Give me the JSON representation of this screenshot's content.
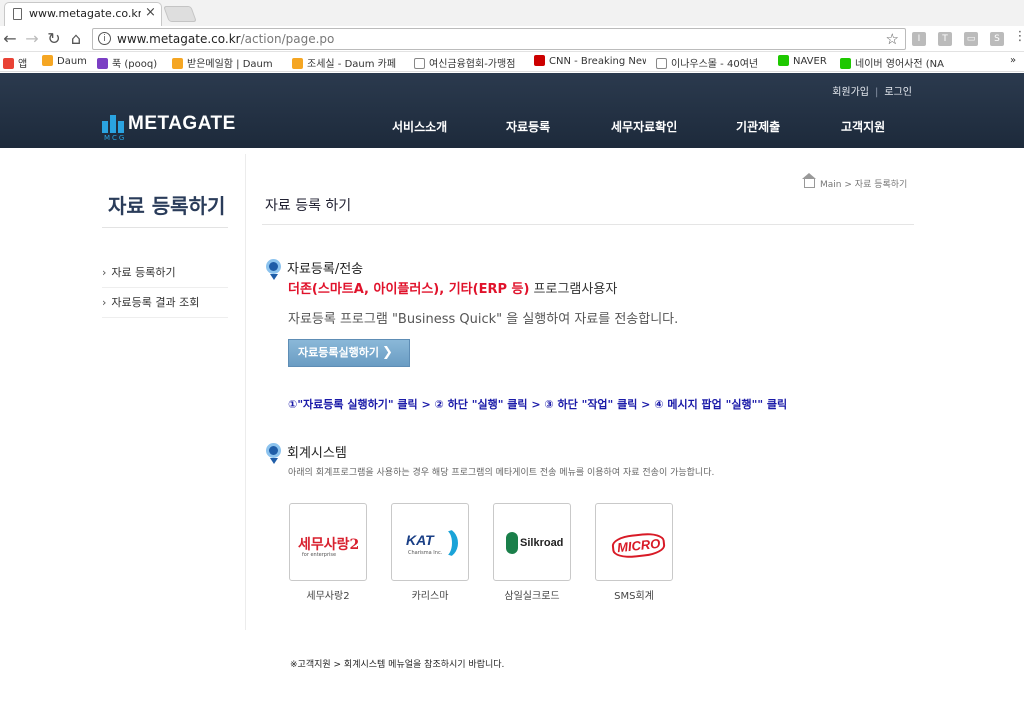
{
  "browser": {
    "tab_title": "www.metagate.co.kr/act",
    "tab_close": "×",
    "url_host": "www.metagate.co.kr",
    "url_path": "/action/page.po",
    "bookmarks": [
      {
        "label": "앱",
        "color": "#e94235"
      },
      {
        "label": "Daum",
        "color": "#f5a623"
      },
      {
        "label": "푹 (pooq)",
        "color": "#7b3fc4"
      },
      {
        "label": "받은메일함 | Daum",
        "color": "#f5a623"
      },
      {
        "label": "조세실 - Daum 카페",
        "color": "#f5a623"
      },
      {
        "label": "여신금융협회-가맹점",
        "color": "#888888"
      },
      {
        "label": "CNN - Breaking New",
        "color": "#cc0000"
      },
      {
        "label": "이나우스몰 - 40여년",
        "color": "#888888"
      },
      {
        "label": "NAVER",
        "color": "#1ec800"
      },
      {
        "label": "네이버 영어사전 (NA",
        "color": "#1ec800"
      }
    ]
  },
  "header": {
    "join": "회원가입",
    "login": "로그인",
    "logo_text": "METAGATE",
    "logo_sub": "MCG",
    "nav": [
      "서비스소개",
      "자료등록",
      "세무자료확인",
      "기관제출",
      "고객지원"
    ]
  },
  "sidebar": {
    "title": "자료 등록하기",
    "items": [
      {
        "label": "자료 등록하기"
      },
      {
        "label": "자료등록 결과 조회"
      }
    ]
  },
  "main": {
    "breadcrumb_home": "Main",
    "breadcrumb_sep": ">",
    "breadcrumb_current": "자료 등록하기",
    "page_title": "자료 등록 하기",
    "section1_title": "자료등록/전송",
    "red_text": "더존(스마트A, 아이플러스), 기타(ERP 등)",
    "red_rest": " 프로그램사용자",
    "desc": "자료등록 프로그램 \"Business Quick\" 을 실행하여 자료를 전송합니다.",
    "run_button": "자료등록실행하기",
    "steps": "①\"자료등록 실행하기\" 클릭 > ② 하단 \"실행\" 클릭 > ③ 하단 \"작업\" 클릭 > ④ 메시지 팝업 \"실행\"\" 클릭",
    "section2_title": "회계시스템",
    "section2_desc": "아래의 회계프로그램을 사용하는 경우 해당 프로그램의 메타게이트 전송 메뉴를 이용하여 자료 전송이 가능합니다.",
    "programs": [
      {
        "label": "세무사랑2",
        "logo": "세무사랑2",
        "logo_sub": "for enterprise"
      },
      {
        "label": "카리스마",
        "logo": "KAT",
        "logo_sub": "Charisma Inc."
      },
      {
        "label": "삼일실크로드",
        "logo": "Silkroad",
        "logo_sub": ""
      },
      {
        "label": "SMS회계",
        "logo": "MICRO",
        "logo_sub": ""
      }
    ],
    "footnote": "※고객지원 > 회계시스템 메뉴얼을 참조하시기 바랍니다."
  }
}
